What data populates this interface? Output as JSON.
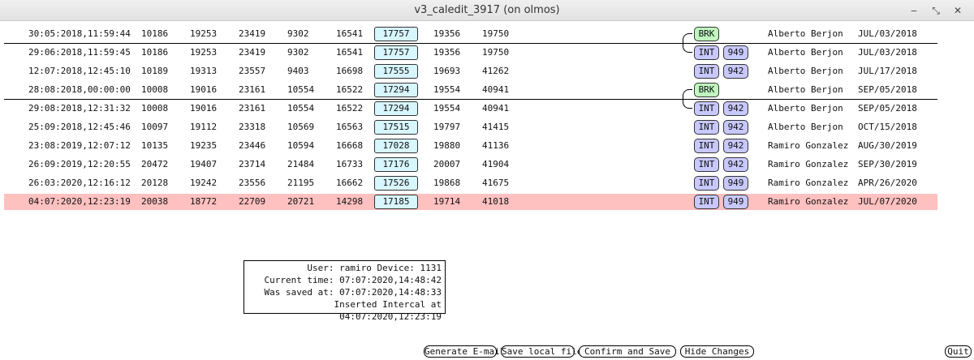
{
  "window": {
    "title": "v3_caledit_3917 (on olmos)"
  },
  "rows": [
    {
      "date": "30:05:2018,11:59:44",
      "v1": "10186",
      "v2": "19253",
      "v3": "23419",
      "v4": "9302",
      "v5": "16541",
      "boxed": "17757",
      "v7": "19356",
      "v8": "19750",
      "type": "BRK",
      "device": "",
      "user": "Alberto Berjon",
      "cal_date": "JUL/03/2018"
    },
    {
      "date": "29:06:2018,11:59:45",
      "v1": "10186",
      "v2": "19253",
      "v3": "23419",
      "v4": "9302",
      "v5": "16541",
      "boxed": "17757",
      "v7": "19356",
      "v8": "19750",
      "type": "INT",
      "device": "949",
      "user": "Alberto Berjon",
      "cal_date": "JUL/03/2018"
    },
    {
      "date": "12:07:2018,12:45:10",
      "v1": "10189",
      "v2": "19313",
      "v3": "23557",
      "v4": "9403",
      "v5": "16698",
      "boxed": "17555",
      "v7": "19693",
      "v8": "41262",
      "type": "INT",
      "device": "942",
      "user": "Alberto Berjon",
      "cal_date": "JUL/17/2018"
    },
    {
      "date": "28:08:2018,00:00:00",
      "v1": "10008",
      "v2": "19016",
      "v3": "23161",
      "v4": "10554",
      "v5": "16522",
      "boxed": "17294",
      "v7": "19554",
      "v8": "40941",
      "type": "BRK",
      "device": "",
      "user": "Alberto Berjon",
      "cal_date": "SEP/05/2018"
    },
    {
      "date": "29:08:2018,12:31:32",
      "v1": "10008",
      "v2": "19016",
      "v3": "23161",
      "v4": "10554",
      "v5": "16522",
      "boxed": "17294",
      "v7": "19554",
      "v8": "40941",
      "type": "INT",
      "device": "942",
      "user": "Alberto Berjon",
      "cal_date": "SEP/05/2018"
    },
    {
      "date": "25:09:2018,12:45:46",
      "v1": "10097",
      "v2": "19112",
      "v3": "23318",
      "v4": "10569",
      "v5": "16563",
      "boxed": "17515",
      "v7": "19797",
      "v8": "41415",
      "type": "INT",
      "device": "942",
      "user": "Alberto Berjon",
      "cal_date": "OCT/15/2018"
    },
    {
      "date": "23:08:2019,12:07:12",
      "v1": "10135",
      "v2": "19235",
      "v3": "23446",
      "v4": "10594",
      "v5": "16668",
      "boxed": "17028",
      "v7": "19880",
      "v8": "41136",
      "type": "INT",
      "device": "942",
      "user": "Ramiro Gonzalez",
      "cal_date": "AUG/30/2019"
    },
    {
      "date": "26:09:2019,12:20:55",
      "v1": "20472",
      "v2": "19407",
      "v3": "23714",
      "v4": "21484",
      "v5": "16733",
      "boxed": "17176",
      "v7": "20007",
      "v8": "41904",
      "type": "INT",
      "device": "942",
      "user": "Ramiro Gonzalez",
      "cal_date": "SEP/30/2019"
    },
    {
      "date": "26:03:2020,12:16:12",
      "v1": "20128",
      "v2": "19242",
      "v3": "23556",
      "v4": "21195",
      "v5": "16662",
      "boxed": "17526",
      "v7": "19868",
      "v8": "41675",
      "type": "INT",
      "device": "949",
      "user": "Ramiro Gonzalez",
      "cal_date": "APR/26/2020"
    },
    {
      "date": "04:07:2020,12:23:19",
      "v1": "20038",
      "v2": "18772",
      "v3": "22709",
      "v4": "20721",
      "v5": "14298",
      "boxed": "17185",
      "v7": "19714",
      "v8": "41018",
      "type": "INT",
      "device": "949",
      "user": "Ramiro Gonzalez",
      "cal_date": "JUL/07/2020",
      "highlighted": true
    }
  ],
  "info": {
    "line1": "User: ramiro Device: 1131",
    "line2": "Current time: 07:07:2020,14:48:42",
    "line3": "Was saved at: 07:07:2020,14:48:33",
    "line4": "Inserted Intercal at 04:07:2020,12:23:19"
  },
  "buttons": {
    "generate_email": "Generate E-mail",
    "save_local": "Save local file",
    "confirm_save": "Confirm and Save",
    "hide_changes": "Hide Changes",
    "quit": "Quit"
  },
  "colors": {
    "highlight_row": "#ffc0c0",
    "boxed_value": "#d7f6ff",
    "int_badge": "#c8c8ff",
    "brk_badge": "#c0f7c0"
  }
}
